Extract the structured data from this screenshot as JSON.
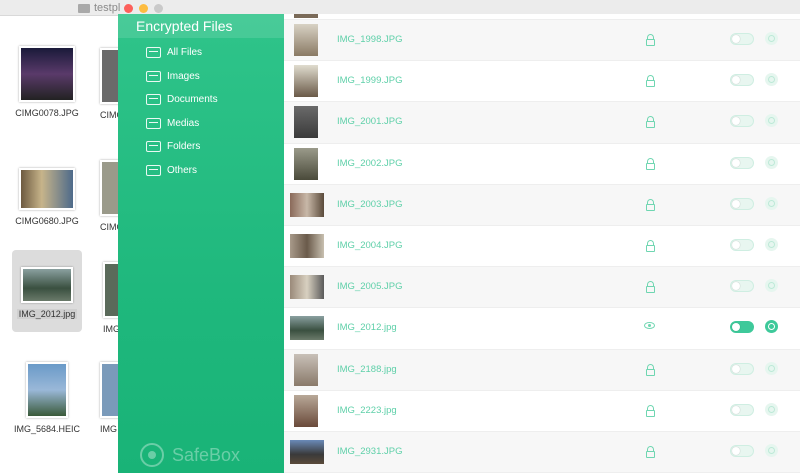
{
  "finder": {
    "path_label": "testpl",
    "items": [
      {
        "name": "CIMG0078.JPG"
      },
      {
        "name": "CIMG0680.JPG"
      },
      {
        "name": "IMG_2012.jpg"
      },
      {
        "name": "IMG_5684.HEIC"
      }
    ],
    "partial_labels": [
      "CIMG",
      "CIMG",
      "IMG",
      "IMG"
    ]
  },
  "sidebar": {
    "title": "Encrypted Files",
    "items": [
      {
        "label": "All Files",
        "icon": "all-files-icon"
      },
      {
        "label": "Images",
        "icon": "images-icon"
      },
      {
        "label": "Documents",
        "icon": "documents-icon"
      },
      {
        "label": "Medias",
        "icon": "medias-icon"
      },
      {
        "label": "Folders",
        "icon": "folders-icon"
      },
      {
        "label": "Others",
        "icon": "others-icon"
      }
    ],
    "brand": "SafeBox"
  },
  "files": [
    {
      "name": "IMG_1998.JPG",
      "status": "locked"
    },
    {
      "name": "IMG_1999.JPG",
      "status": "locked"
    },
    {
      "name": "IMG_2001.JPG",
      "status": "locked"
    },
    {
      "name": "IMG_2002.JPG",
      "status": "locked"
    },
    {
      "name": "IMG_2003.JPG",
      "status": "locked"
    },
    {
      "name": "IMG_2004.JPG",
      "status": "locked"
    },
    {
      "name": "IMG_2005.JPG",
      "status": "locked"
    },
    {
      "name": "IMG_2012.jpg",
      "status": "visible"
    },
    {
      "name": "IMG_2188.jpg",
      "status": "locked"
    },
    {
      "name": "IMG_2223.jpg",
      "status": "locked"
    },
    {
      "name": "IMG_2931.JPG",
      "status": "locked"
    }
  ],
  "colors": {
    "accent": "#2fc48a",
    "accent_dark": "#19b377",
    "text_green": "#5fd0a9"
  }
}
